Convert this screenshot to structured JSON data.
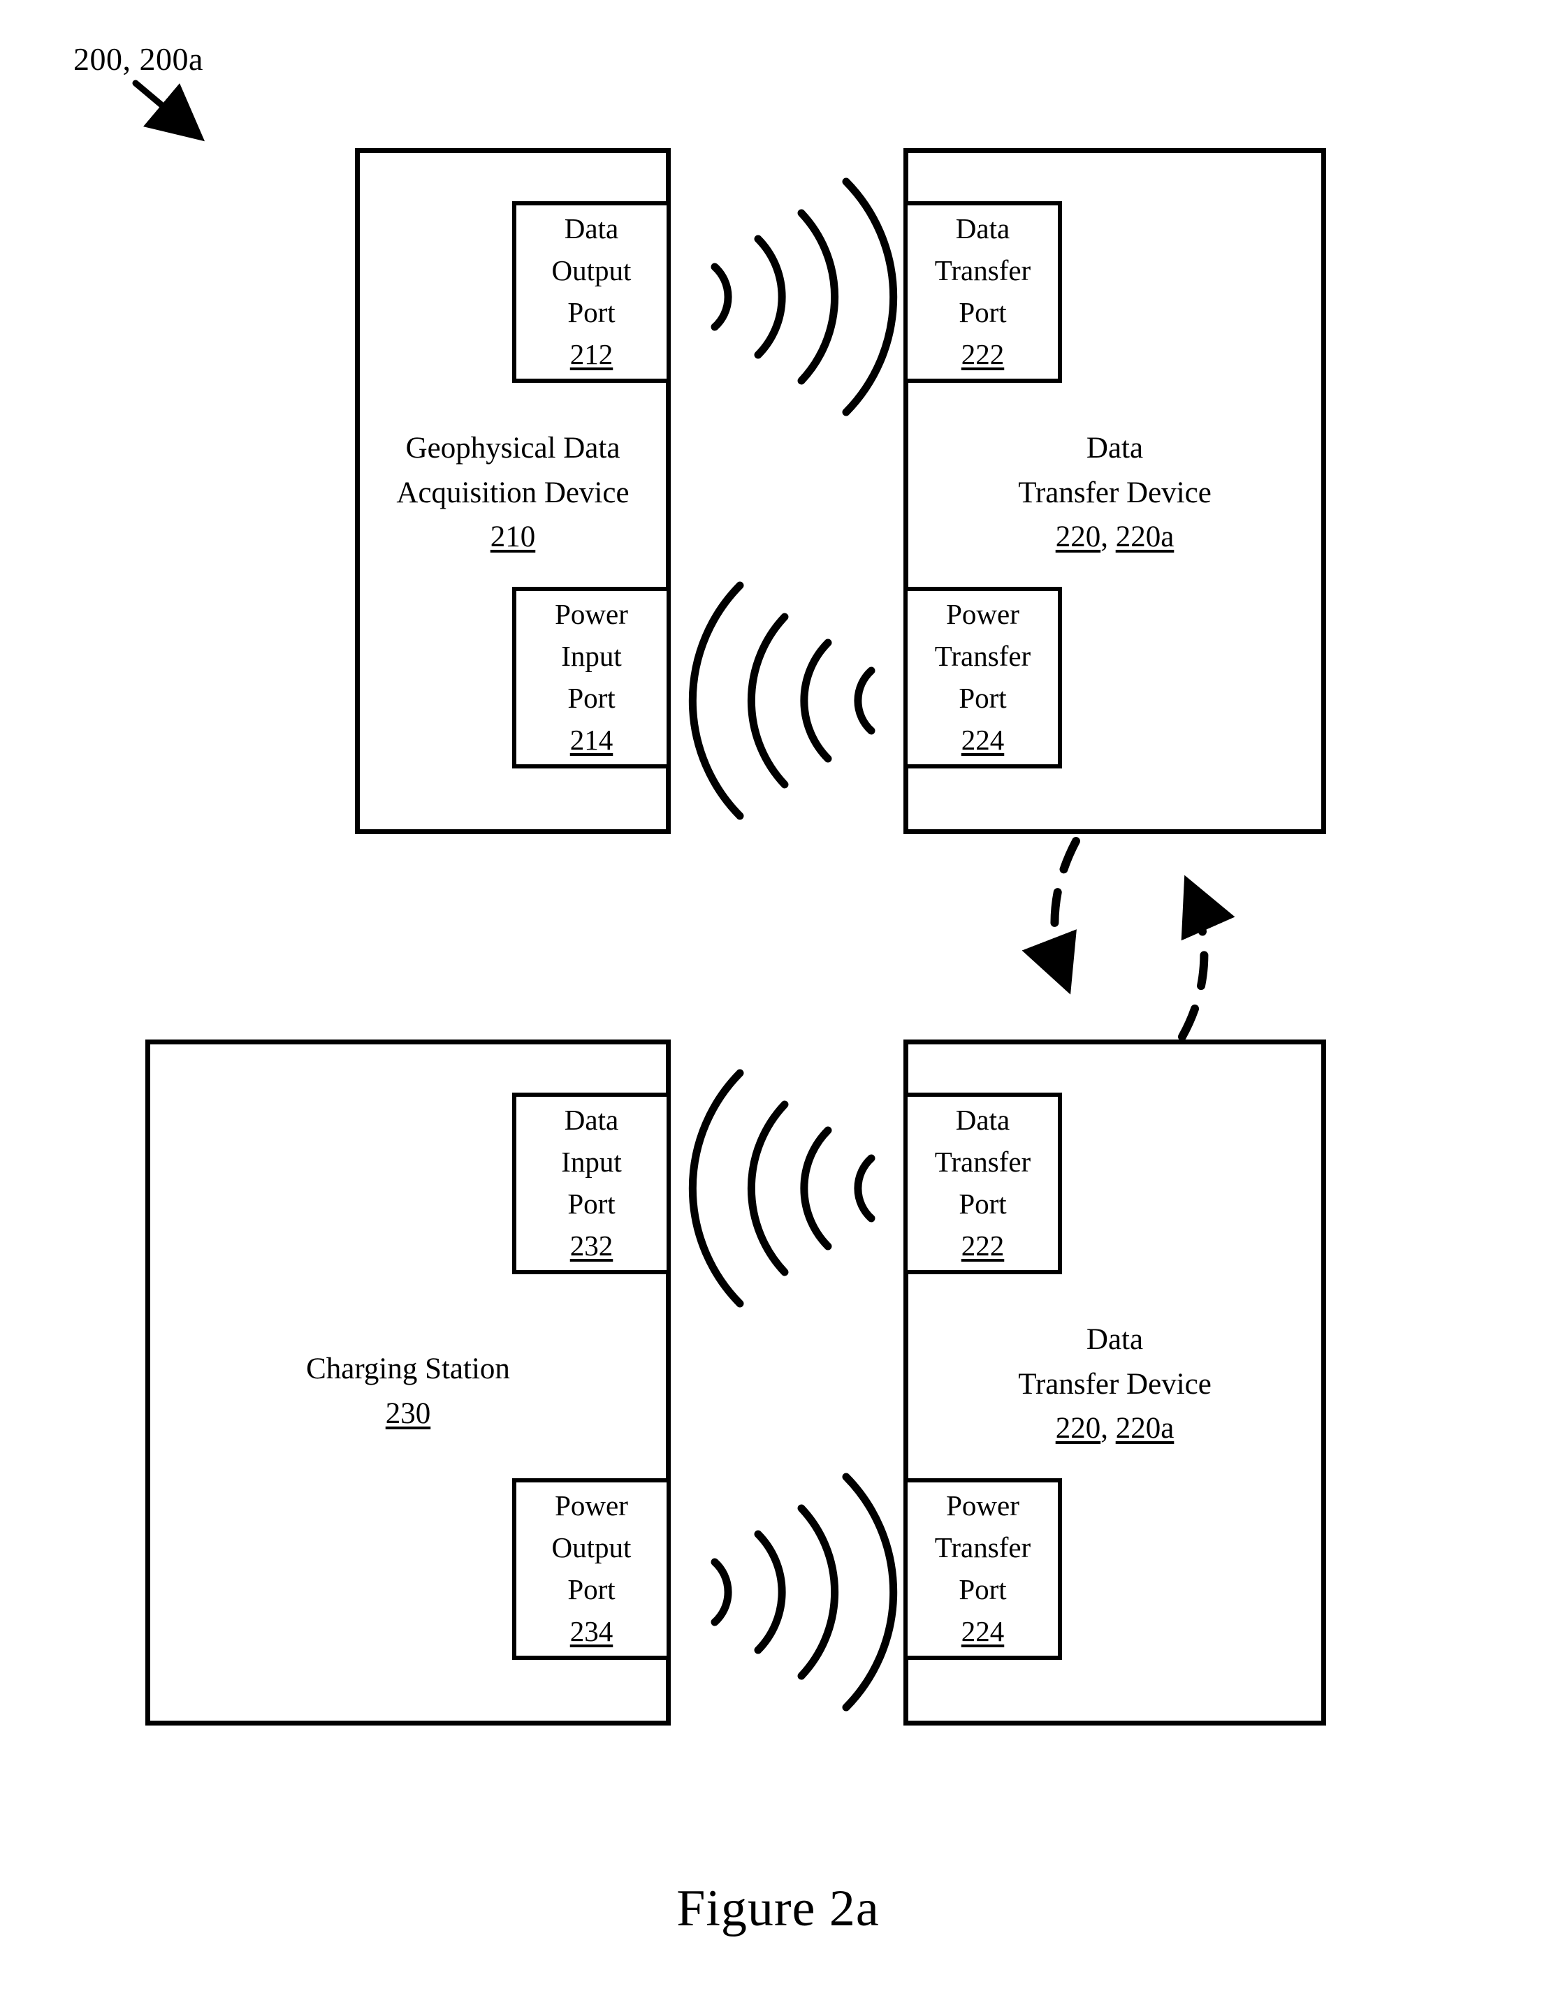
{
  "figure": {
    "caption": "Figure 2a",
    "reference_numeral": "200, 200a"
  },
  "top_section": {
    "left_device": {
      "title_line1": "Geophysical Data",
      "title_line2": "Acquisition Device",
      "number": "210",
      "ports": [
        {
          "name": "data-output-port",
          "line1": "Data",
          "line2": "Output",
          "line3": "Port",
          "number": "212"
        },
        {
          "name": "power-input-port",
          "line1": "Power",
          "line2": "Input",
          "line3": "Port",
          "number": "214"
        }
      ]
    },
    "right_device": {
      "title_line1": "Data",
      "title_line2": "Transfer Device",
      "number": "220",
      "number_alt": "220a",
      "number_separator": ", ",
      "ports": [
        {
          "name": "data-transfer-port",
          "line1": "Data",
          "line2": "Transfer",
          "line3": "Port",
          "number": "222"
        },
        {
          "name": "power-transfer-port",
          "line1": "Power",
          "line2": "Transfer",
          "line3": "Port",
          "number": "224"
        }
      ]
    },
    "signals": [
      {
        "name": "data-signal-top",
        "direction": "left-to-right",
        "arc_count": 4
      },
      {
        "name": "power-signal-top",
        "direction": "right-to-left",
        "arc_count": 4
      }
    ]
  },
  "bottom_section": {
    "left_device": {
      "title_line1": "Charging Station",
      "number": "230",
      "ports": [
        {
          "name": "data-input-port",
          "line1": "Data",
          "line2": "Input",
          "line3": "Port",
          "number": "232"
        },
        {
          "name": "power-output-port",
          "line1": "Power",
          "line2": "Output",
          "line3": "Port",
          "number": "234"
        }
      ]
    },
    "right_device": {
      "title_line1": "Data",
      "title_line2": "Transfer Device",
      "number": "220",
      "number_alt": "220a",
      "number_separator": ", ",
      "ports": [
        {
          "name": "data-transfer-port",
          "line1": "Data",
          "line2": "Transfer",
          "line3": "Port",
          "number": "222"
        },
        {
          "name": "power-transfer-port",
          "line1": "Power",
          "line2": "Transfer",
          "line3": "Port",
          "number": "224"
        }
      ]
    },
    "signals": [
      {
        "name": "data-signal-bottom",
        "direction": "right-to-left",
        "arc_count": 4
      },
      {
        "name": "power-signal-bottom",
        "direction": "left-to-right",
        "arc_count": 4
      }
    ]
  },
  "connector": {
    "name": "bidirectional-dashed-exchange",
    "style": "dashed",
    "arrow_down_label": "",
    "arrow_up_label": ""
  },
  "colors": {
    "stroke": "#000000",
    "background": "#ffffff"
  }
}
